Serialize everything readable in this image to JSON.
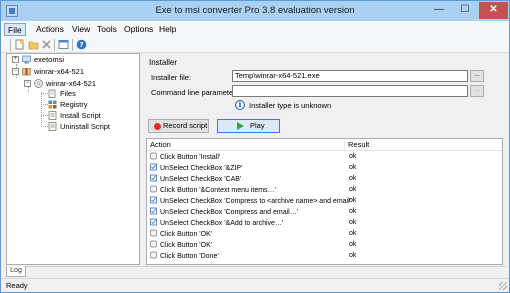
{
  "window": {
    "title": "Exe to msi converter Pro 3.8 evaluation version",
    "minimize_glyph": "—",
    "maximize_glyph": "☐",
    "close_glyph": "✕"
  },
  "menu": {
    "items": [
      {
        "label": "File"
      },
      {
        "label": "Actions"
      },
      {
        "label": "View"
      },
      {
        "label": "Tools"
      },
      {
        "label": "Options"
      },
      {
        "label": "Help"
      }
    ]
  },
  "toolbar": {
    "icons": [
      "new-icon",
      "open-icon",
      "delete-icon",
      "properties-icon",
      "help-icon"
    ]
  },
  "tree": {
    "root1": {
      "label": "exetomsi",
      "toggle": "+"
    },
    "root2": {
      "label": "winrar-x64-521",
      "toggle": "−"
    },
    "child": {
      "label": "winrar-x64-521",
      "toggle": "−"
    },
    "leaves": [
      {
        "label": "Files"
      },
      {
        "label": "Registry"
      },
      {
        "label": "Install Script"
      },
      {
        "label": "Uninstall Script"
      }
    ]
  },
  "installer": {
    "heading": "Installer",
    "file_label": "Installer file:",
    "file_value": "Temp\\winrar-x64-521.exe",
    "params_label": "Command line parameters:",
    "params_value": "",
    "browse_label": "...",
    "info_glyph": "i",
    "info_text": "Installer type is unknown"
  },
  "buttons": {
    "record": "Record script",
    "play": "Play"
  },
  "table": {
    "headers": {
      "action": "Action",
      "result": "Result"
    },
    "rows": [
      {
        "action": "Click Button 'Install'",
        "result": "ok",
        "icon": "button"
      },
      {
        "action": "UnSelect CheckBox '&ZIP'",
        "result": "ok",
        "icon": "checkbox"
      },
      {
        "action": "UnSelect CheckBox 'CAB'",
        "result": "ok",
        "icon": "checkbox"
      },
      {
        "action": "Click Button '&Context menu items…'",
        "result": "ok",
        "icon": "button"
      },
      {
        "action": "UnSelect CheckBox 'Compress to <archive name> and email'",
        "result": "ok",
        "icon": "checkbox"
      },
      {
        "action": "UnSelect CheckBox 'Compress and email…'",
        "result": "ok",
        "icon": "checkbox"
      },
      {
        "action": "UnSelect CheckBox '&Add to archive…'",
        "result": "ok",
        "icon": "checkbox"
      },
      {
        "action": "Click Button 'OK'",
        "result": "ok",
        "icon": "button"
      },
      {
        "action": "Click Button 'OK'",
        "result": "ok",
        "icon": "button"
      },
      {
        "action": "Click Button 'Done'",
        "result": "ok",
        "icon": "button"
      }
    ]
  },
  "log_tab": "Log",
  "status": "Ready"
}
